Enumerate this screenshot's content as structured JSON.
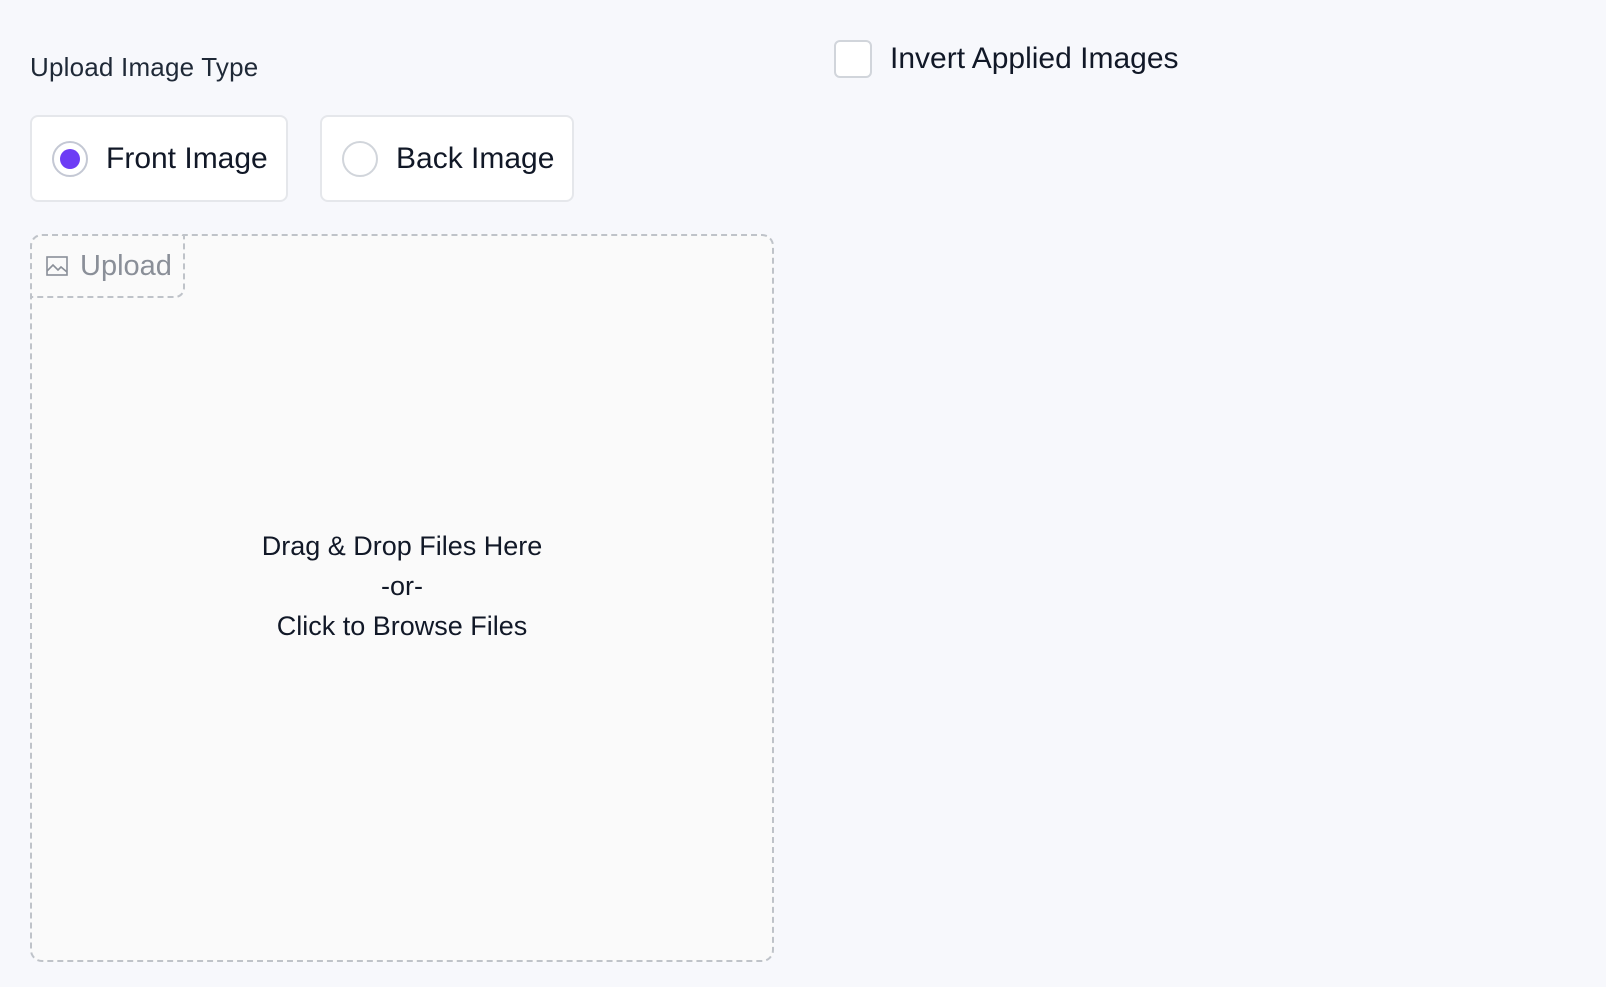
{
  "upload_type": {
    "label": "Upload Image Type",
    "options": [
      {
        "label": "Front Image",
        "selected": true
      },
      {
        "label": "Back Image",
        "selected": false
      }
    ]
  },
  "invert": {
    "label": "Invert Applied Images",
    "checked": false
  },
  "dropzone": {
    "tab_label": "Upload",
    "tab_icon": "image-icon",
    "line1": "Drag & Drop Files Here",
    "line2": "-or-",
    "line3": "Click to Browse Files"
  },
  "colors": {
    "accent": "#6d3cf5",
    "background": "#f7f8fc"
  }
}
